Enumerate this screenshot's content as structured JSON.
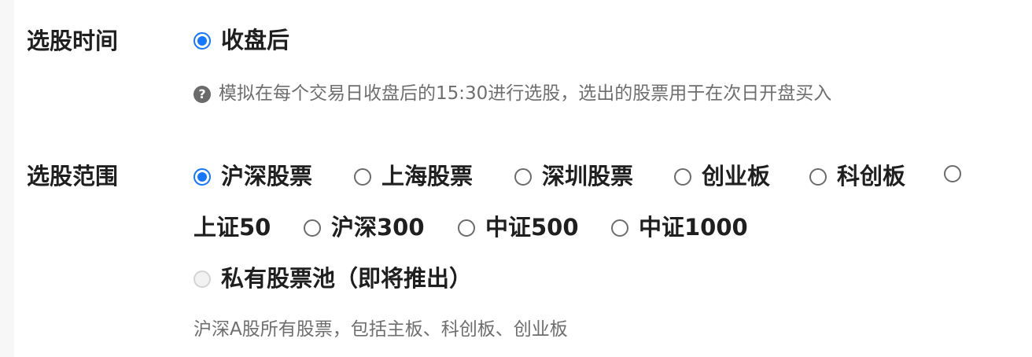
{
  "fields": {
    "time": {
      "label": "选股时间",
      "option": "收盘后",
      "hint": "模拟在每个交易日收盘后的15:30进行选股，选出的股票用于在次日开盘买入",
      "help_icon_glyph": "?"
    },
    "scope": {
      "label": "选股范围",
      "options": [
        {
          "label": "沪深股票",
          "checked": true
        },
        {
          "label": "上海股票",
          "checked": false
        },
        {
          "label": "深圳股票",
          "checked": false
        },
        {
          "label": "创业板",
          "checked": false
        },
        {
          "label": "科创板",
          "checked": false
        },
        {
          "label": "上证50",
          "checked": false
        },
        {
          "label": "沪深300",
          "checked": false
        },
        {
          "label": "中证500",
          "checked": false
        },
        {
          "label": "中证1000",
          "checked": false
        },
        {
          "label": "私有股票池（即将推出）",
          "checked": false,
          "disabled": true
        }
      ],
      "hint": "沪深A股所有股票，包括主板、科创板、创业板"
    }
  },
  "colors": {
    "accent": "#1677ff",
    "hint_text": "#6e6e6e",
    "label_text": "#1f1f1f"
  }
}
